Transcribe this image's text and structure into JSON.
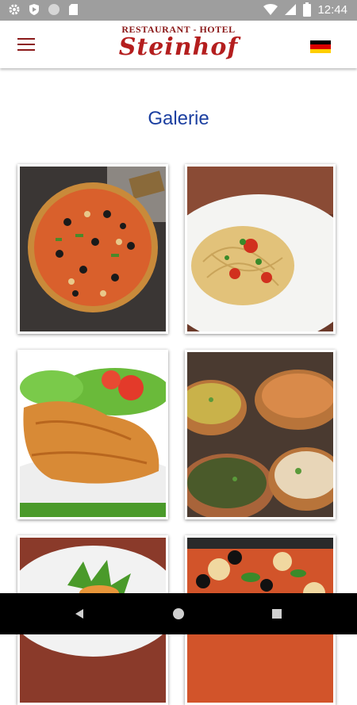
{
  "status_bar": {
    "time": "12:44",
    "icons": [
      "gear-icon",
      "shield-icon",
      "circle-icon",
      "sd-card-icon",
      "wifi-icon",
      "signal-icon",
      "battery-icon"
    ]
  },
  "header": {
    "menu_icon": "hamburger-icon",
    "logo_top": "RESTAURANT - HOTEL",
    "logo_main": "Steinhof",
    "language_flag": "german-flag",
    "brand_color": "#b41e1e"
  },
  "page": {
    "title": "Galerie",
    "title_color": "#1b3fa0"
  },
  "gallery": {
    "images": [
      {
        "subject": "pizza"
      },
      {
        "subject": "spaghetti"
      },
      {
        "subject": "schnitzel with salad"
      },
      {
        "subject": "curry bowls"
      },
      {
        "subject": "salad plate"
      },
      {
        "subject": "pizza with olives"
      }
    ]
  },
  "nav_bar": {
    "buttons": [
      "back-icon",
      "home-icon",
      "recents-icon"
    ]
  }
}
